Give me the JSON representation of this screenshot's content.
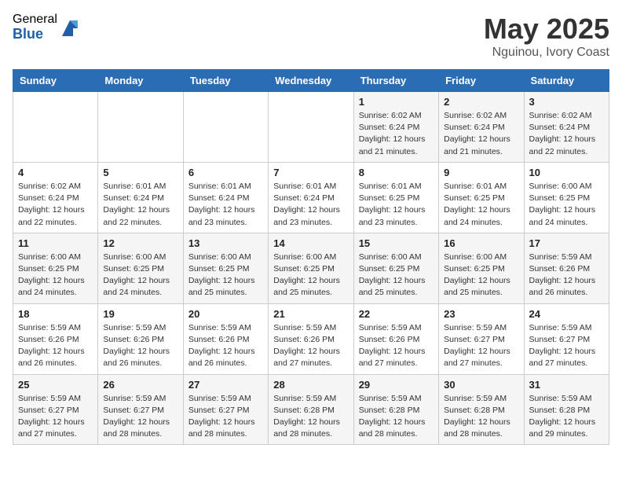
{
  "header": {
    "logo_general": "General",
    "logo_blue": "Blue",
    "month_title": "May 2025",
    "location": "Nguinou, Ivory Coast"
  },
  "days_of_week": [
    "Sunday",
    "Monday",
    "Tuesday",
    "Wednesday",
    "Thursday",
    "Friday",
    "Saturday"
  ],
  "weeks": [
    [
      {
        "day": "",
        "info": ""
      },
      {
        "day": "",
        "info": ""
      },
      {
        "day": "",
        "info": ""
      },
      {
        "day": "",
        "info": ""
      },
      {
        "day": "1",
        "info": "Sunrise: 6:02 AM\nSunset: 6:24 PM\nDaylight: 12 hours\nand 21 minutes."
      },
      {
        "day": "2",
        "info": "Sunrise: 6:02 AM\nSunset: 6:24 PM\nDaylight: 12 hours\nand 21 minutes."
      },
      {
        "day": "3",
        "info": "Sunrise: 6:02 AM\nSunset: 6:24 PM\nDaylight: 12 hours\nand 22 minutes."
      }
    ],
    [
      {
        "day": "4",
        "info": "Sunrise: 6:02 AM\nSunset: 6:24 PM\nDaylight: 12 hours\nand 22 minutes."
      },
      {
        "day": "5",
        "info": "Sunrise: 6:01 AM\nSunset: 6:24 PM\nDaylight: 12 hours\nand 22 minutes."
      },
      {
        "day": "6",
        "info": "Sunrise: 6:01 AM\nSunset: 6:24 PM\nDaylight: 12 hours\nand 23 minutes."
      },
      {
        "day": "7",
        "info": "Sunrise: 6:01 AM\nSunset: 6:24 PM\nDaylight: 12 hours\nand 23 minutes."
      },
      {
        "day": "8",
        "info": "Sunrise: 6:01 AM\nSunset: 6:25 PM\nDaylight: 12 hours\nand 23 minutes."
      },
      {
        "day": "9",
        "info": "Sunrise: 6:01 AM\nSunset: 6:25 PM\nDaylight: 12 hours\nand 24 minutes."
      },
      {
        "day": "10",
        "info": "Sunrise: 6:00 AM\nSunset: 6:25 PM\nDaylight: 12 hours\nand 24 minutes."
      }
    ],
    [
      {
        "day": "11",
        "info": "Sunrise: 6:00 AM\nSunset: 6:25 PM\nDaylight: 12 hours\nand 24 minutes."
      },
      {
        "day": "12",
        "info": "Sunrise: 6:00 AM\nSunset: 6:25 PM\nDaylight: 12 hours\nand 24 minutes."
      },
      {
        "day": "13",
        "info": "Sunrise: 6:00 AM\nSunset: 6:25 PM\nDaylight: 12 hours\nand 25 minutes."
      },
      {
        "day": "14",
        "info": "Sunrise: 6:00 AM\nSunset: 6:25 PM\nDaylight: 12 hours\nand 25 minutes."
      },
      {
        "day": "15",
        "info": "Sunrise: 6:00 AM\nSunset: 6:25 PM\nDaylight: 12 hours\nand 25 minutes."
      },
      {
        "day": "16",
        "info": "Sunrise: 6:00 AM\nSunset: 6:25 PM\nDaylight: 12 hours\nand 25 minutes."
      },
      {
        "day": "17",
        "info": "Sunrise: 5:59 AM\nSunset: 6:26 PM\nDaylight: 12 hours\nand 26 minutes."
      }
    ],
    [
      {
        "day": "18",
        "info": "Sunrise: 5:59 AM\nSunset: 6:26 PM\nDaylight: 12 hours\nand 26 minutes."
      },
      {
        "day": "19",
        "info": "Sunrise: 5:59 AM\nSunset: 6:26 PM\nDaylight: 12 hours\nand 26 minutes."
      },
      {
        "day": "20",
        "info": "Sunrise: 5:59 AM\nSunset: 6:26 PM\nDaylight: 12 hours\nand 26 minutes."
      },
      {
        "day": "21",
        "info": "Sunrise: 5:59 AM\nSunset: 6:26 PM\nDaylight: 12 hours\nand 27 minutes."
      },
      {
        "day": "22",
        "info": "Sunrise: 5:59 AM\nSunset: 6:26 PM\nDaylight: 12 hours\nand 27 minutes."
      },
      {
        "day": "23",
        "info": "Sunrise: 5:59 AM\nSunset: 6:27 PM\nDaylight: 12 hours\nand 27 minutes."
      },
      {
        "day": "24",
        "info": "Sunrise: 5:59 AM\nSunset: 6:27 PM\nDaylight: 12 hours\nand 27 minutes."
      }
    ],
    [
      {
        "day": "25",
        "info": "Sunrise: 5:59 AM\nSunset: 6:27 PM\nDaylight: 12 hours\nand 27 minutes."
      },
      {
        "day": "26",
        "info": "Sunrise: 5:59 AM\nSunset: 6:27 PM\nDaylight: 12 hours\nand 28 minutes."
      },
      {
        "day": "27",
        "info": "Sunrise: 5:59 AM\nSunset: 6:27 PM\nDaylight: 12 hours\nand 28 minutes."
      },
      {
        "day": "28",
        "info": "Sunrise: 5:59 AM\nSunset: 6:28 PM\nDaylight: 12 hours\nand 28 minutes."
      },
      {
        "day": "29",
        "info": "Sunrise: 5:59 AM\nSunset: 6:28 PM\nDaylight: 12 hours\nand 28 minutes."
      },
      {
        "day": "30",
        "info": "Sunrise: 5:59 AM\nSunset: 6:28 PM\nDaylight: 12 hours\nand 28 minutes."
      },
      {
        "day": "31",
        "info": "Sunrise: 5:59 AM\nSunset: 6:28 PM\nDaylight: 12 hours\nand 29 minutes."
      }
    ]
  ]
}
